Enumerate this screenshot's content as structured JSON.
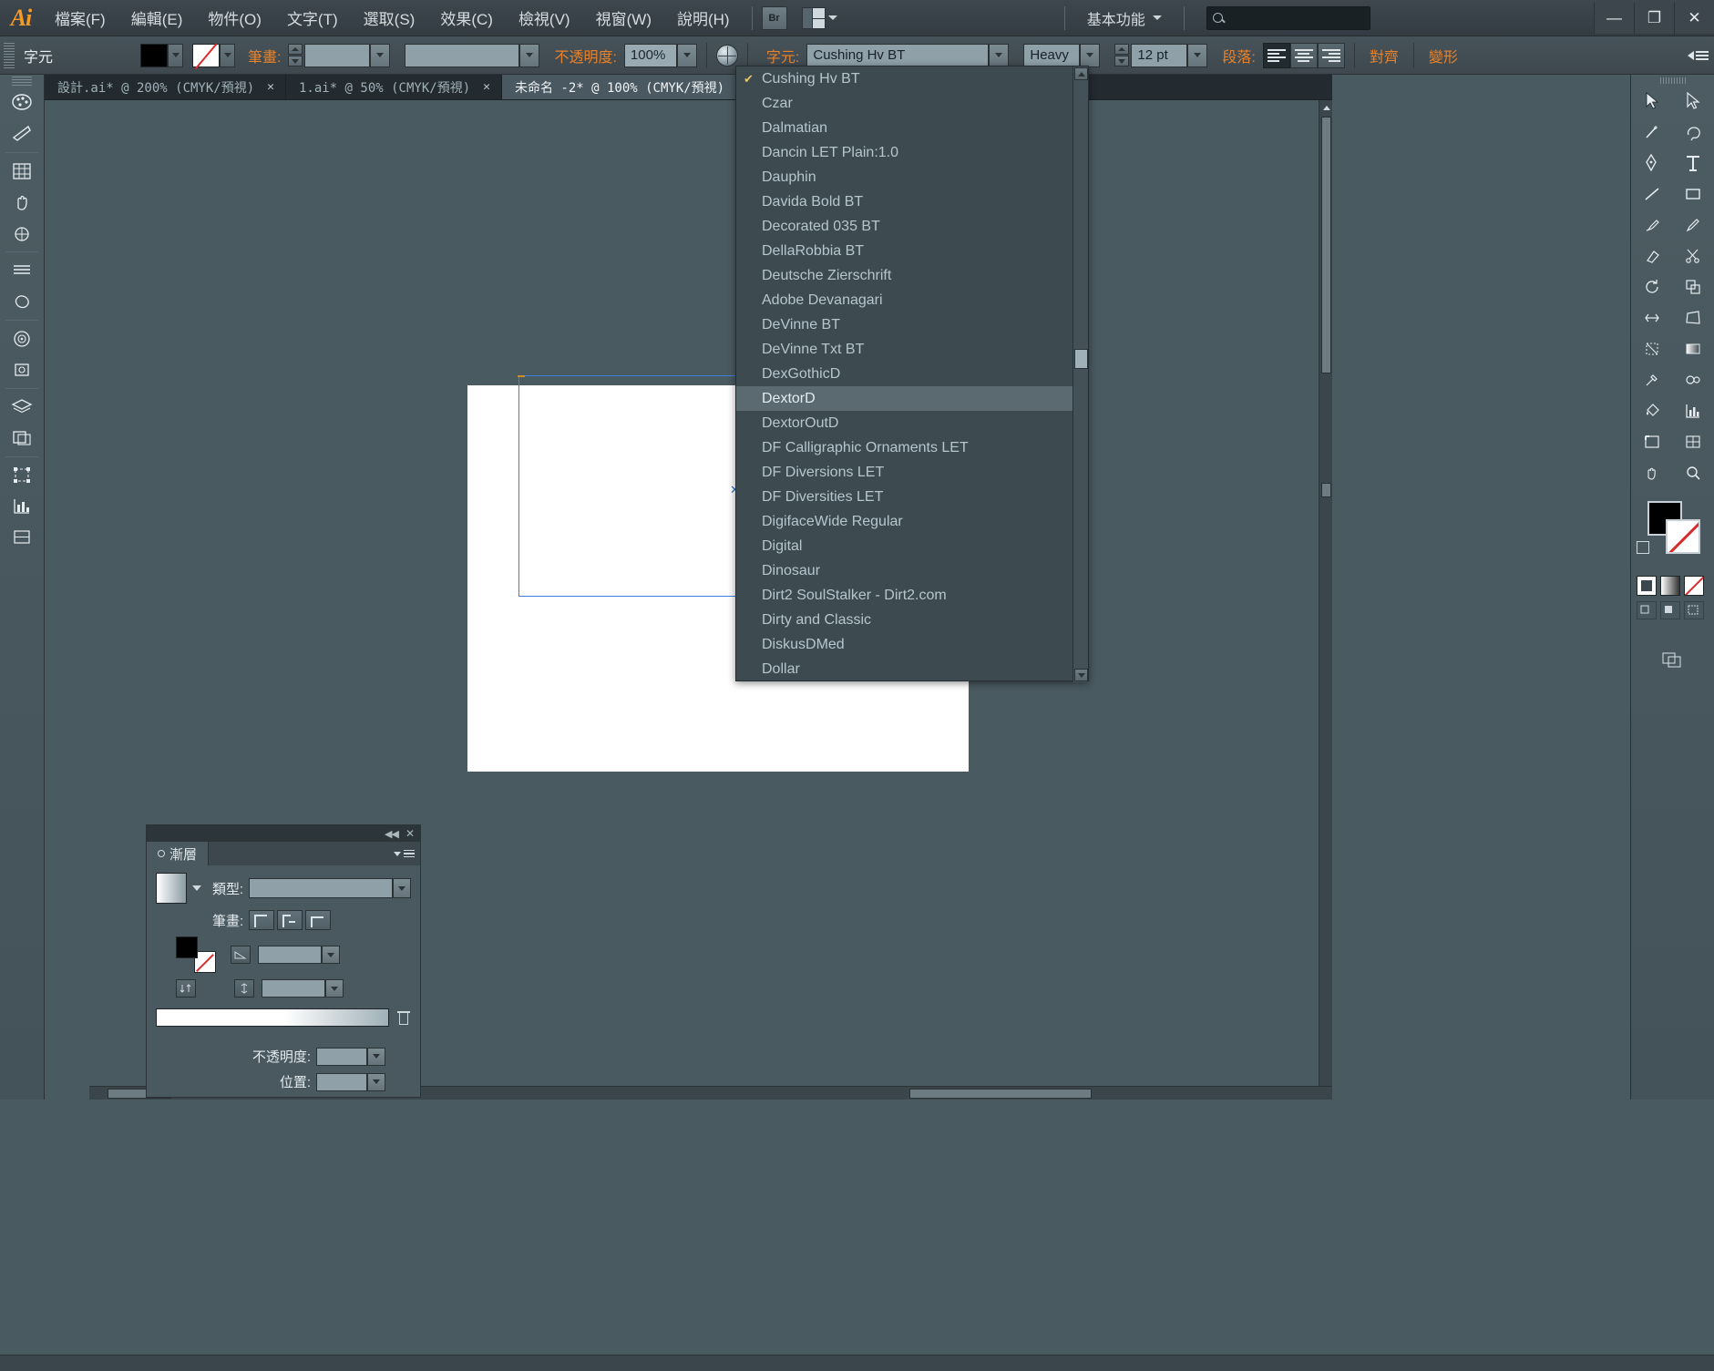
{
  "app": {
    "logo": "Ai",
    "menus": [
      {
        "label": "檔案(F)"
      },
      {
        "label": "編輯(E)"
      },
      {
        "label": "物件(O)"
      },
      {
        "label": "文字(T)"
      },
      {
        "label": "選取(S)"
      },
      {
        "label": "效果(C)"
      },
      {
        "label": "檢視(V)"
      },
      {
        "label": "視窗(W)"
      },
      {
        "label": "說明(H)"
      }
    ],
    "bridge_button": "Br",
    "workspace": "基本功能",
    "search_placeholder": "",
    "search_value": "",
    "window_buttons": {
      "minimize": "—",
      "restore": "❐",
      "close": "✕"
    }
  },
  "control_bar": {
    "context_label": "字元",
    "stroke_label": "筆畫:",
    "stroke_weight": "",
    "stroke_profile": "",
    "opacity_label": "不透明度:",
    "opacity_value": "100%",
    "font_label": "字元:",
    "font_family": "Cushing Hv BT",
    "font_style": "Heavy",
    "font_size": "12 pt",
    "paragraph_label": "段落:",
    "align_left": "align-left",
    "align_center": "align-center",
    "align_right": "align-right",
    "align_button": "對齊",
    "transform_button": "變形"
  },
  "tabs": [
    {
      "label": "設計.ai* @ 200% (CMYK/預視)",
      "close": "✕",
      "active": false
    },
    {
      "label": "1.ai* @ 50% (CMYK/預視)",
      "close": "✕",
      "active": false
    },
    {
      "label": "未命名 -2* @ 100% (CMYK/預視)",
      "close": "✕",
      "active": true
    }
  ],
  "font_dropdown": {
    "items": [
      {
        "label": "Cushing Hv BT",
        "checked": true,
        "highlight": false
      },
      {
        "label": "Czar",
        "checked": false,
        "highlight": false
      },
      {
        "label": "Dalmatian",
        "checked": false,
        "highlight": false
      },
      {
        "label": "Dancin LET Plain:1.0",
        "checked": false,
        "highlight": false
      },
      {
        "label": "Dauphin",
        "checked": false,
        "highlight": false
      },
      {
        "label": "Davida Bold BT",
        "checked": false,
        "highlight": false
      },
      {
        "label": "Decorated 035 BT",
        "checked": false,
        "highlight": false
      },
      {
        "label": "DellaRobbia BT",
        "checked": false,
        "highlight": false
      },
      {
        "label": "Deutsche Zierschrift",
        "checked": false,
        "highlight": false
      },
      {
        "label": "Adobe Devanagari",
        "checked": false,
        "highlight": false
      },
      {
        "label": "DeVinne BT",
        "checked": false,
        "highlight": false
      },
      {
        "label": "DeVinne Txt BT",
        "checked": false,
        "highlight": false
      },
      {
        "label": "DexGothicD",
        "checked": false,
        "highlight": false
      },
      {
        "label": "DextorD",
        "checked": false,
        "highlight": true
      },
      {
        "label": "DextorOutD",
        "checked": false,
        "highlight": false
      },
      {
        "label": "DF Calligraphic Ornaments LET",
        "checked": false,
        "highlight": false
      },
      {
        "label": "DF Diversions LET",
        "checked": false,
        "highlight": false
      },
      {
        "label": "DF Diversities LET",
        "checked": false,
        "highlight": false
      },
      {
        "label": "DigifaceWide Regular",
        "checked": false,
        "highlight": false
      },
      {
        "label": "Digital",
        "checked": false,
        "highlight": false
      },
      {
        "label": "Dinosaur",
        "checked": false,
        "highlight": false
      },
      {
        "label": "Dirt2 SoulStalker - Dirt2.com",
        "checked": false,
        "highlight": false
      },
      {
        "label": "Dirty and Classic",
        "checked": false,
        "highlight": false
      },
      {
        "label": "DiskusDMed",
        "checked": false,
        "highlight": false
      },
      {
        "label": "Dollar",
        "checked": false,
        "highlight": false
      }
    ]
  },
  "gradient_panel": {
    "title": "漸層",
    "type_label": "類型:",
    "type_value": "",
    "stroke_label": "筆畫:",
    "angle_value": "",
    "aspect_value": "",
    "opacity_label": "不透明度:",
    "opacity_value": "",
    "location_label": "位置:",
    "location_value": "",
    "collapse_icon": "◀◀",
    "close_icon": "✕"
  },
  "colors": {
    "accent_orange": "#e8822a",
    "panel_bg": "#4a585f",
    "canvas_bg": "#4a5a61",
    "menu_bg": "#3d474d",
    "highlight": "#5b6a71",
    "selection_blue": "#3f7fe0",
    "artboard": "#ffffff"
  }
}
